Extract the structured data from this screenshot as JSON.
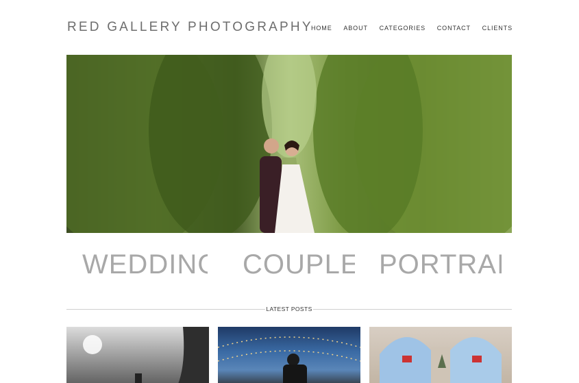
{
  "header": {
    "site_title": "RED GALLERY PHOTOGRAPHY",
    "nav": [
      "HOME",
      "ABOUT",
      "CATEGORIES",
      "CONTACT",
      "CLIENTS"
    ]
  },
  "categories": [
    "WEDDINGS",
    "COUPLES",
    "PORTRAITS"
  ],
  "latest_posts": {
    "label": "LATEST POSTS"
  }
}
